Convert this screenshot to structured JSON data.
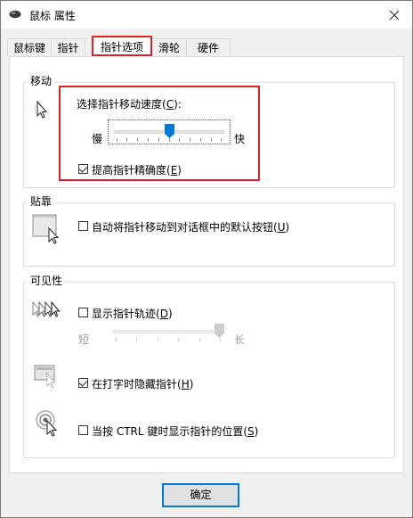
{
  "window": {
    "title": "鼠标 属性"
  },
  "tabs": [
    {
      "label": "鼠标键"
    },
    {
      "label": "指针"
    },
    {
      "label": "指针选项"
    },
    {
      "label": "滑轮"
    },
    {
      "label": "硬件"
    }
  ],
  "active_tab": "指针选项",
  "motion": {
    "group_title": "移动",
    "speed_label": "选择指针移动速度(",
    "speed_key": "C",
    "speed_tail": "):",
    "slow": "慢",
    "fast": "快",
    "speed_value": 0.5,
    "precision_label": "提高指针精确度(",
    "precision_key": "E",
    "precision_tail": ")",
    "precision_checked": true
  },
  "snap": {
    "group_title": "贴靠",
    "label": "自动将指针移动到对话框中的默认按钮(",
    "key": "U",
    "tail": ")",
    "checked": false
  },
  "visibility": {
    "group_title": "可见性",
    "trails_label": "显示指针轨迹(",
    "trails_key": "D",
    "trails_tail": ")",
    "trails_checked": false,
    "short": "短",
    "long": "长",
    "trails_value": 1.0,
    "hide_label": "在打字时隐藏指针(",
    "hide_key": "H",
    "hide_tail": ")",
    "hide_checked": true,
    "ctrl_label": "当按 CTRL 键时显示指针的位置(",
    "ctrl_key": "S",
    "ctrl_tail": ")",
    "ctrl_checked": false
  },
  "buttons": {
    "ok": "确定"
  },
  "colors": {
    "highlight": "#e0212b",
    "focus": "#0078d7",
    "thumb": "#0078d7"
  },
  "icons": [
    "mouse-icon",
    "close-icon",
    "pointer-speed-icon",
    "snap-to-icon",
    "pointer-trails-icon",
    "hide-pointer-icon",
    "ctrl-locate-icon"
  ]
}
